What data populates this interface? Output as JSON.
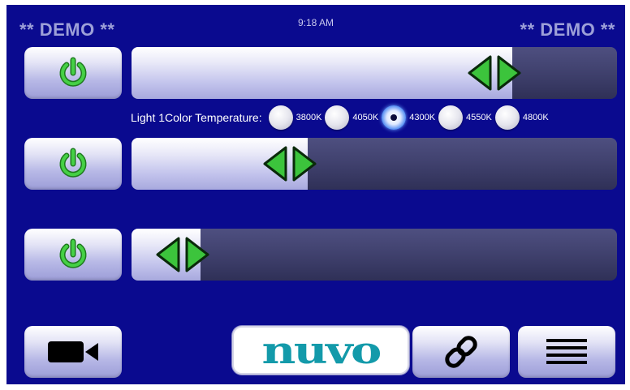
{
  "header": {
    "demo_left": "** DEMO **",
    "demo_right": "** DEMO **",
    "time": "9:18 AM"
  },
  "lights": [
    {
      "power_icon": "power-icon",
      "level_percent": 78.4
    },
    {
      "power_icon": "power-icon",
      "level_percent": 36.3
    },
    {
      "power_icon": "power-icon",
      "level_percent": 14.2
    }
  ],
  "color_temperature": {
    "label": "Light 1Color Temperature:",
    "options": [
      "3800K",
      "4050K",
      "4300K",
      "4550K",
      "4800K"
    ],
    "selected": "4300K"
  },
  "bottom_bar": {
    "camera_icon": "video-camera-icon",
    "logo": "nuvo",
    "link_icon": "link-icon",
    "menu_icon": "menu-icon"
  },
  "colors": {
    "background": "#0a0a8f",
    "accent_green": "#3cc43c",
    "logo_teal": "#139aaa"
  }
}
